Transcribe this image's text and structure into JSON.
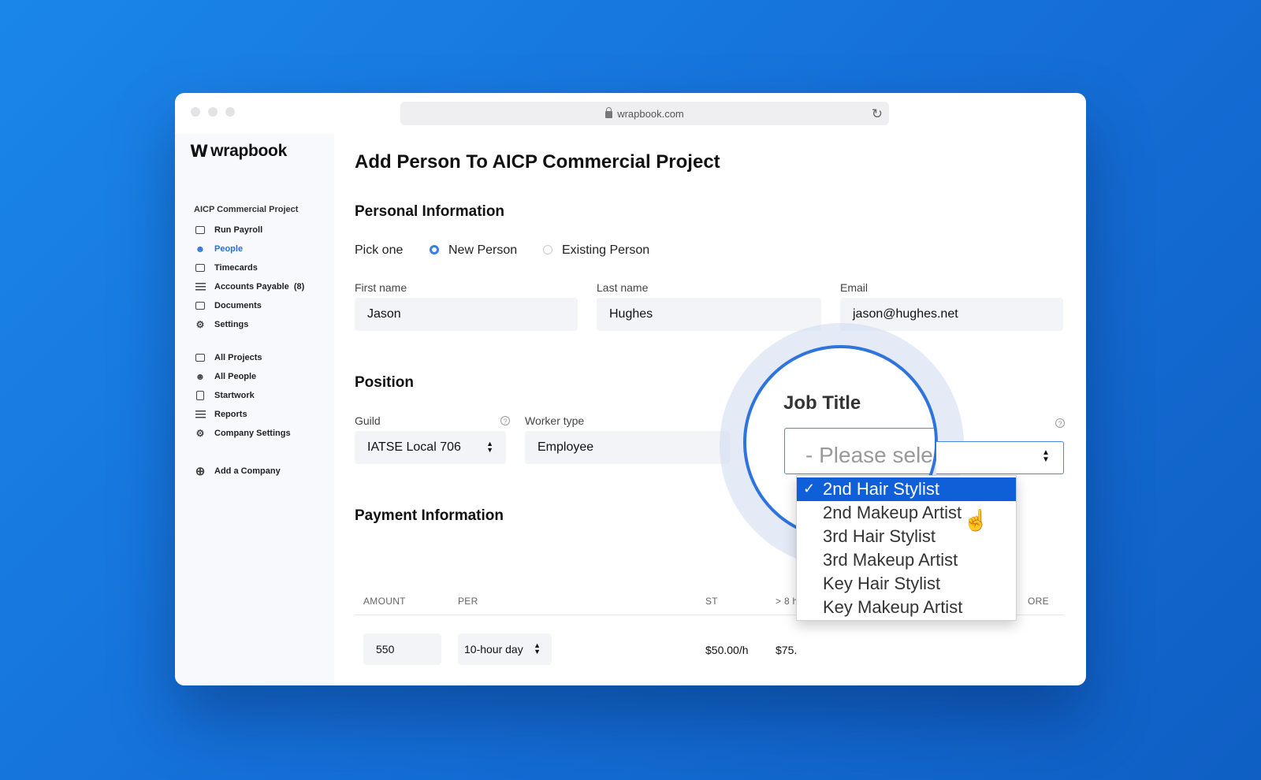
{
  "browser": {
    "url": "wrapbook.com"
  },
  "brand": {
    "name": "wrapbook",
    "accent": "#2a6fd6"
  },
  "sidebar": {
    "project": "AICP Commercial Project",
    "project_items": [
      {
        "label": "Run Payroll",
        "icon": "card-icon"
      },
      {
        "label": "People",
        "icon": "people-icon",
        "active": true
      },
      {
        "label": "Timecards",
        "icon": "calendar-icon"
      },
      {
        "label": "Accounts Payable  (8)",
        "icon": "list-icon"
      },
      {
        "label": "Documents",
        "icon": "folder-icon"
      },
      {
        "label": "Settings",
        "icon": "gear-icon"
      }
    ],
    "company_items": [
      {
        "label": "All Projects",
        "icon": "projects-icon"
      },
      {
        "label": "All People",
        "icon": "people-icon"
      },
      {
        "label": "Startwork",
        "icon": "document-icon"
      },
      {
        "label": "Reports",
        "icon": "reports-icon"
      },
      {
        "label": "Company Settings",
        "icon": "gear-icon"
      }
    ],
    "add_company": "Add a Company"
  },
  "main": {
    "title": "Add Person To AICP Commercial Project",
    "personal": {
      "heading": "Personal Information",
      "pick_label": "Pick one",
      "options": [
        "New Person",
        "Existing Person"
      ],
      "selected": "New Person",
      "first_name_label": "First name",
      "first_name": "Jason",
      "last_name_label": "Last name",
      "last_name": "Hughes",
      "email_label": "Email",
      "email": "jason@hughes.net"
    },
    "position": {
      "heading": "Position",
      "guild_label": "Guild",
      "guild": "IATSE Local 706",
      "worker_type_label": "Worker type",
      "worker_type": "Employee",
      "job_title_label": "Job Title",
      "job_title_placeholder": "- Please sele",
      "job_title_options": [
        "2nd Hair Stylist",
        "2nd Makeup Artist",
        "3rd Hair Stylist",
        "3rd Makeup Artist",
        "Key Hair Stylist",
        "Key Makeup Artist"
      ],
      "job_title_highlighted": "2nd Hair Stylist"
    },
    "payment": {
      "heading": "Payment Information",
      "columns": [
        "AMOUNT",
        "PER",
        "ST",
        "> 8 h",
        "ORE"
      ],
      "amount": "550",
      "per": "10-hour day",
      "st": "$50.00/h",
      "ot": "$75."
    }
  }
}
